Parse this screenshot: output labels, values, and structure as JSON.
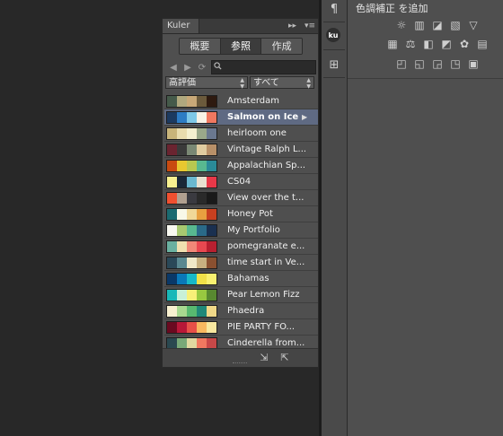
{
  "kuler": {
    "tab_title": "Kuler",
    "collapse_glyph": "▸▸",
    "menu_glyph": "▾≡",
    "mode_tabs": [
      {
        "label": "概要",
        "active": false
      },
      {
        "label": "参照",
        "active": true
      },
      {
        "label": "作成",
        "active": false
      }
    ],
    "search": {
      "value": "",
      "placeholder": ""
    },
    "filter_sort": "高評価",
    "filter_time": "すべて",
    "themes": [
      {
        "name": "Amsterdam",
        "colors": [
          "#455a4a",
          "#b0a87e",
          "#c8a878",
          "#6b5a3c",
          "#2e1a10"
        ]
      },
      {
        "name": "Salmon on Ice",
        "selected": true,
        "colors": [
          "#1c3a60",
          "#2d7cc4",
          "#7ec8e8",
          "#f8f2e6",
          "#f07860"
        ]
      },
      {
        "name": "heirloom one",
        "colors": [
          "#c8b47a",
          "#e8dcae",
          "#f4f0d0",
          "#9aa88a",
          "#6a7890"
        ]
      },
      {
        "name": "Vintage Ralph L...",
        "colors": [
          "#6a2430",
          "#3a3a3a",
          "#7a8874",
          "#e0cca0",
          "#b89068"
        ]
      },
      {
        "name": "Appalachian Sp...",
        "colors": [
          "#c84a10",
          "#e8c830",
          "#b8c850",
          "#58b890",
          "#2a8a98"
        ]
      },
      {
        "name": "CS04",
        "colors": [
          "#f8f090",
          "#1a2838",
          "#6ab8d0",
          "#e8e0d0",
          "#e83848"
        ]
      },
      {
        "name": "View over the t...",
        "colors": [
          "#f05030",
          "#b0a090",
          "#3a3a40",
          "#2a2a2a",
          "#1a1a1a"
        ]
      },
      {
        "name": "Honey Pot",
        "colors": [
          "#1a6a70",
          "#f8f8e8",
          "#f0d898",
          "#e8a040",
          "#c84020"
        ]
      },
      {
        "name": "My Portfolio",
        "colors": [
          "#f8f8f0",
          "#a8c870",
          "#58b890",
          "#2a6a88",
          "#1a3050"
        ]
      },
      {
        "name": "pomegranate e...",
        "colors": [
          "#6ab0a0",
          "#f0e0b0",
          "#f08878",
          "#e84850",
          "#b82030"
        ]
      },
      {
        "name": "time start in Ve...",
        "colors": [
          "#2a4858",
          "#5a8890",
          "#f0e8c8",
          "#c8b080",
          "#8a5030"
        ]
      },
      {
        "name": "Bahamas",
        "colors": [
          "#0a3868",
          "#0a78b8",
          "#18b8c8",
          "#f0e048",
          "#f8f070"
        ]
      },
      {
        "name": "Pear Lemon Fizz",
        "colors": [
          "#18b8b8",
          "#c8f0d8",
          "#f8f078",
          "#98c840",
          "#588830"
        ]
      },
      {
        "name": "Phaedra",
        "colors": [
          "#f8f0d0",
          "#a8d890",
          "#58b870",
          "#208878",
          "#f0d888"
        ]
      },
      {
        "name": "PIE PARTY  FO...",
        "colors": [
          "#6a0a20",
          "#b81838",
          "#e85048",
          "#f8b860",
          "#f8e8a0"
        ]
      },
      {
        "name": "Cinderella from...",
        "colors": [
          "#2a4850",
          "#78a878",
          "#e0d8a0",
          "#f07860",
          "#c84848"
        ]
      }
    ]
  },
  "side_strip": {
    "paragraph_glyph": "¶",
    "kuler_badge": "ku",
    "transform_glyph": "⊞"
  },
  "adjustments": {
    "title": "色調補正 を追加",
    "row1": [
      "☼",
      "▥",
      "◪",
      "▧",
      "▽"
    ],
    "row2": [
      "▦",
      "⚖",
      "◧",
      "◩",
      "✿",
      "▤"
    ],
    "row3": [
      "◰",
      "◱",
      "◲",
      "◳",
      "▣"
    ]
  }
}
